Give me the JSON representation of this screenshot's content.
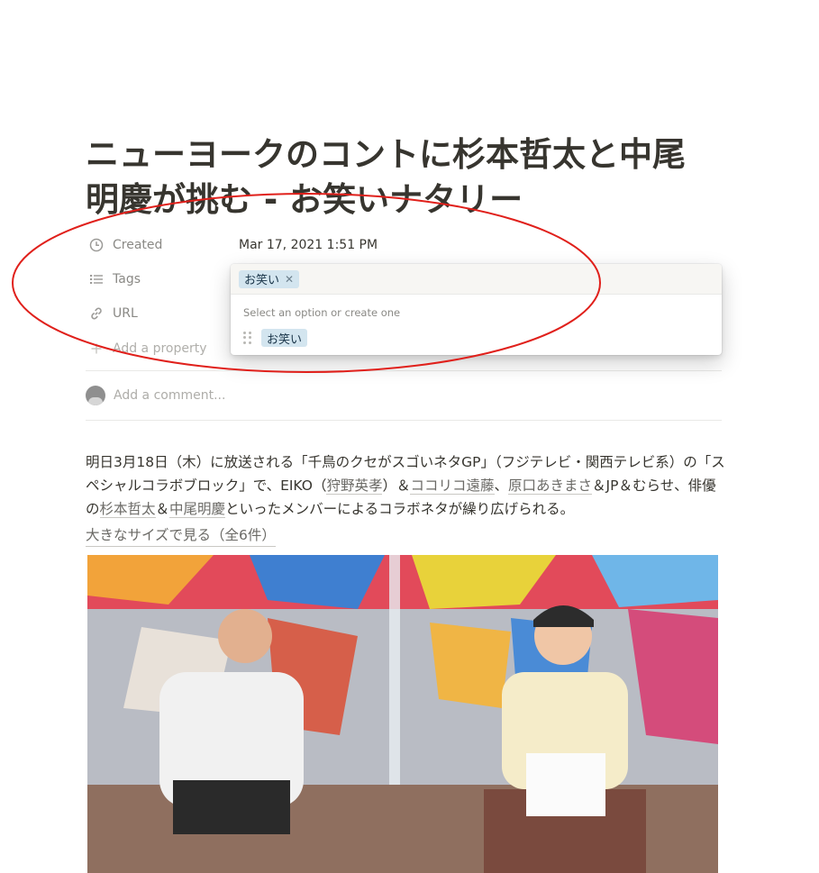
{
  "page": {
    "title": "ニューヨークのコントに杉本哲太と中尾明慶が挑む - お笑いナタリー"
  },
  "properties": [
    {
      "icon": "clock-icon",
      "label": "Created",
      "value": "Mar 17, 2021 1:51 PM"
    },
    {
      "icon": "list-icon",
      "label": "Tags",
      "value": ""
    },
    {
      "icon": "link-icon",
      "label": "URL",
      "value": ""
    }
  ],
  "add_property": {
    "icon": "plus-icon",
    "label": "Add a property"
  },
  "comment": {
    "placeholder": "Add a comment..."
  },
  "tag_popup": {
    "selected_tag": "お笑い",
    "hint": "Select an option or create one",
    "options": [
      {
        "label": "お笑い"
      }
    ]
  },
  "article": {
    "paragraph_parts": [
      "明日3月18日（木）に放送される「千鳥のクセがスゴいネタGP」（フジテレビ・関西テレビ系）の「スペシャルコラボブロック」で、EIKO（",
      "狩野英孝",
      "）＆",
      "ココリコ遠藤",
      "、",
      "原口あきまさ",
      "＆JP＆むらせ、俳優の",
      "杉本哲太",
      "＆",
      "中尾明慶",
      "といったメンバーによるコラボネタが繰り広げられる。"
    ],
    "view_larger_link": "大きなサイズで見る（全6件）"
  },
  "colors": {
    "annotation_circle": "#e0201b",
    "tag_background": "#d3e5ef",
    "text": "#37352f",
    "muted": "#8a8985"
  }
}
